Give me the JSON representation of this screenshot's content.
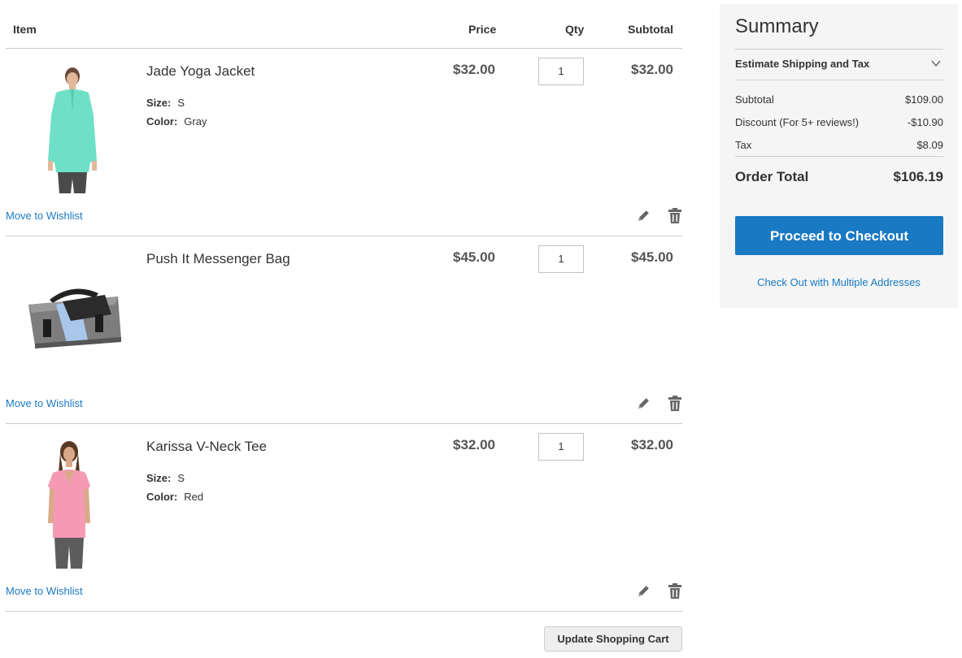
{
  "columns": {
    "item": "Item",
    "price": "Price",
    "qty": "Qty",
    "subtotal": "Subtotal"
  },
  "items": [
    {
      "name": "Jade Yoga Jacket",
      "size_label": "Size:",
      "size": "S",
      "color_label": "Color:",
      "color": "Gray",
      "price": "$32.00",
      "qty": "1",
      "subtotal": "$32.00",
      "wishlist_label": "Move to Wishlist",
      "image_icon": "jacket-product-image"
    },
    {
      "name": "Push It Messenger Bag",
      "price": "$45.00",
      "qty": "1",
      "subtotal": "$45.00",
      "wishlist_label": "Move to Wishlist",
      "image_icon": "bag-product-image"
    },
    {
      "name": "Karissa V-Neck Tee",
      "size_label": "Size:",
      "size": "S",
      "color_label": "Color:",
      "color": "Red",
      "price": "$32.00",
      "qty": "1",
      "subtotal": "$32.00",
      "wishlist_label": "Move to Wishlist",
      "image_icon": "tee-product-image"
    }
  ],
  "update_cart_label": "Update Shopping Cart",
  "summary": {
    "title": "Summary",
    "estimate_label": "Estimate Shipping and Tax",
    "subtotal_label": "Subtotal",
    "subtotal_value": "$109.00",
    "discount_label": "Discount (For 5+ reviews!)",
    "discount_value": "-$10.90",
    "tax_label": "Tax",
    "tax_value": "$8.09",
    "order_total_label": "Order Total",
    "order_total_value": "$106.19",
    "checkout_label": "Proceed to Checkout",
    "multi_address_label": "Check Out with Multiple Addresses"
  },
  "colors": {
    "accent": "#1979c3",
    "summary_bg": "#f5f5f5",
    "button_bg": "#eeeeee"
  },
  "icons": [
    "pencil-edit-icon",
    "trash-delete-icon",
    "chevron-down-icon"
  ]
}
